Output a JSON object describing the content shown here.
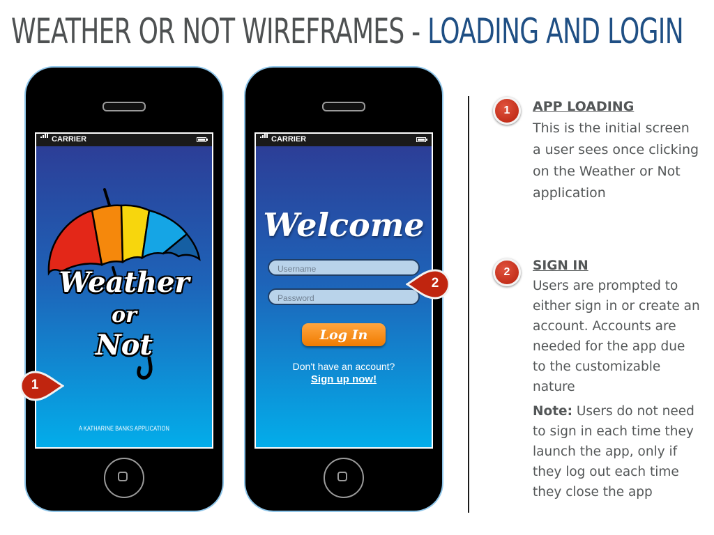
{
  "title": {
    "part1": "WEATHER OR NOT WIREFRAMES - ",
    "part2": "LOADING AND LOGIN"
  },
  "colors": {
    "title_gray": "#4e5152",
    "title_blue": "#1f4f84",
    "phone_border": "#8fc6ea",
    "screen_gradient_top": "#2c3e97",
    "screen_gradient_bottom": "#03adea",
    "login_button": "#f58a12",
    "callout_red": "#c0250f",
    "note_text": "#535657"
  },
  "status_bar": {
    "carrier": "CARRIER"
  },
  "loading_screen": {
    "logo_line1": "Weather",
    "logo_line2": "or",
    "logo_line3": "Not",
    "tagline": "A KATHARINE BANKS APPLICATION",
    "icon": "umbrella-icon"
  },
  "login_screen": {
    "welcome": "Welcome",
    "username_placeholder": "Username",
    "password_placeholder": "Password",
    "login_button": "Log In",
    "no_account_prompt": "Don't have an account?",
    "signup_link": "Sign up now!"
  },
  "callouts": [
    {
      "number": "1"
    },
    {
      "number": "2"
    }
  ],
  "notes": [
    {
      "number": "1",
      "heading": "APP LOADING",
      "body": "This is the initial screen a user sees once clicking on the Weather or Not application"
    },
    {
      "number": "2",
      "heading": "SIGN IN",
      "body": "Users are prompted to either sign in or create an account. Accounts are needed for the app due to the customizable nature"
    }
  ],
  "extra_note": {
    "label": "Note:",
    "text": " Users do not need to sign in each time they launch the app, only if they log out each time they close the app"
  }
}
